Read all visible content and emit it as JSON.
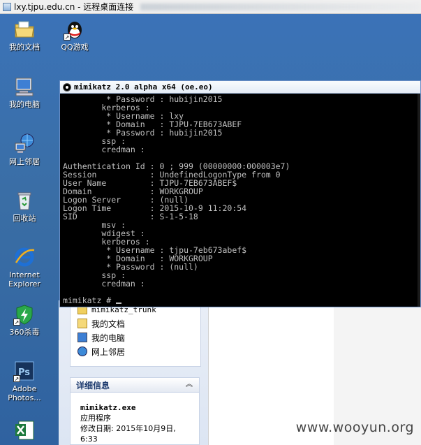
{
  "remote_desktop": {
    "title": "lxy.tjpu.edu.cn - 远程桌面连接"
  },
  "desktop_icons": [
    {
      "label": "我的文档",
      "icon": "my-documents-icon"
    },
    {
      "label": "QQ游戏",
      "icon": "qq-game-icon"
    },
    {
      "label": "我的电脑",
      "icon": "my-computer-icon"
    },
    {
      "label": "网上邻居",
      "icon": "network-places-icon"
    },
    {
      "label": "回收站",
      "icon": "recycle-bin-icon"
    },
    {
      "label": "Internet Explorer",
      "label_line1": "Internet",
      "label_line2": "Explorer",
      "icon": "internet-explorer-icon"
    },
    {
      "label": "360杀毒",
      "icon": "antivirus-360-icon"
    },
    {
      "label": "Adobe Photos...",
      "label_line1": "Adobe",
      "label_line2": "Photos...",
      "icon": "photoshop-icon"
    },
    {
      "label": "",
      "icon": "excel-icon"
    }
  ],
  "console": {
    "title": "mimikatz 2.0 alpha x64 (oe.eo)",
    "lines": [
      "         * Password : hubijin2015",
      "        kerberos :",
      "         * Username : lxy",
      "         * Domain   : TJPU-7EB673ABEF",
      "         * Password : hubijin2015",
      "        ssp :",
      "        credman :",
      "",
      "Authentication Id : 0 ; 999 (00000000:000003e7)",
      "Session           : UndefinedLogonType from 0",
      "User Name         : TJPU-7EB673ABEF$",
      "Domain            : WORKGROUP",
      "Logon Server      : (null)",
      "Logon Time        : 2015-10-9 11:20:54",
      "SID               : S-1-5-18",
      "        msv :",
      "        wdigest :",
      "        kerberos :",
      "         * Username : tjpu-7eb673abef$",
      "         * Domain   : WORKGROUP",
      "         * Password : (null)",
      "        ssp :",
      "        credman :",
      "",
      "mimikatz # "
    ]
  },
  "explorer": {
    "tasks": [
      {
        "label": "mimikatz_trunk",
        "icon": "folder-icon"
      },
      {
        "label": "我的文档",
        "icon": "my-documents-icon"
      },
      {
        "label": "我的电脑",
        "icon": "my-computer-icon"
      },
      {
        "label": "网上邻居",
        "icon": "network-places-icon"
      }
    ],
    "details": {
      "title": "详细信息",
      "file_name": "mimikatz.exe",
      "file_type": "应用程序",
      "modified_label": "修改日期: 2015年10月9日,",
      "modified_time": "6:33"
    }
  },
  "watermark": "www.wooyun.org"
}
